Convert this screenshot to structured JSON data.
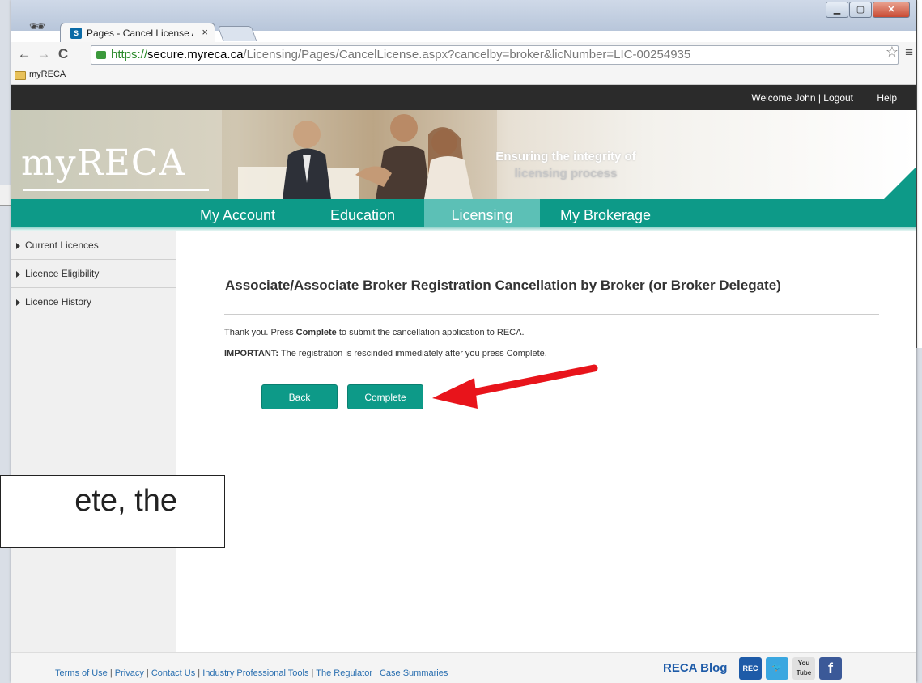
{
  "browser": {
    "tab_title": "Pages - Cancel License Ap",
    "tab_close": "×",
    "url_scheme": "https://",
    "url_host": "secure.myreca.ca",
    "url_path": "/Licensing/Pages/CancelLicense.aspx?cancelby=broker&licNumber=LIC-00254935",
    "bookmark_folder": "myRECA",
    "icons": [
      "back-arrow-icon",
      "forward-arrow-icon",
      "reload-icon",
      "lock-icon",
      "star-icon",
      "menu-icon",
      "incognito-icon",
      "folder-icon"
    ]
  },
  "site": {
    "topbar": {
      "welcome": "Welcome John | Logout",
      "help": "Help"
    },
    "banner": {
      "logo": "myRECA",
      "tagline_line1": "Ensuring the integrity of",
      "tagline_line2": "licensing process"
    },
    "nav": [
      {
        "label": "My Account"
      },
      {
        "label": "Education"
      },
      {
        "label": "Licensing"
      },
      {
        "label": "My Brokerage"
      }
    ],
    "active_nav": "Licensing",
    "sidebar": [
      {
        "label": "Current Licences"
      },
      {
        "label": "Licence Eligibility"
      },
      {
        "label": "Licence History"
      }
    ],
    "main": {
      "title": "Associate/Associate Broker Registration Cancellation by Broker (or Broker Delegate)",
      "msg1_pre": "Thank you. Press ",
      "msg1_bold": "Complete",
      "msg1_post": " to submit the cancellation application to RECA.",
      "msg2_bold": "IMPORTANT:",
      "msg2_post": " The registration is rescinded immediately after you press Complete.",
      "back_label": "Back",
      "complete_label": "Complete"
    },
    "footer": {
      "links": [
        "Terms of Use",
        "Privacy",
        "Contact Us",
        "Industry Professional Tools",
        "The Regulator",
        "Case Summaries"
      ],
      "blog_label": "RECA Blog",
      "social": [
        "REC",
        "You Tube",
        "f"
      ]
    }
  },
  "overlay_caption": "ete, the",
  "colors": {
    "teal": "#0d9a88",
    "teal_active": "#5cc0b6",
    "topbar": "#2b2b2b",
    "arrow": "#e8141b",
    "link": "#2a6fb0"
  }
}
